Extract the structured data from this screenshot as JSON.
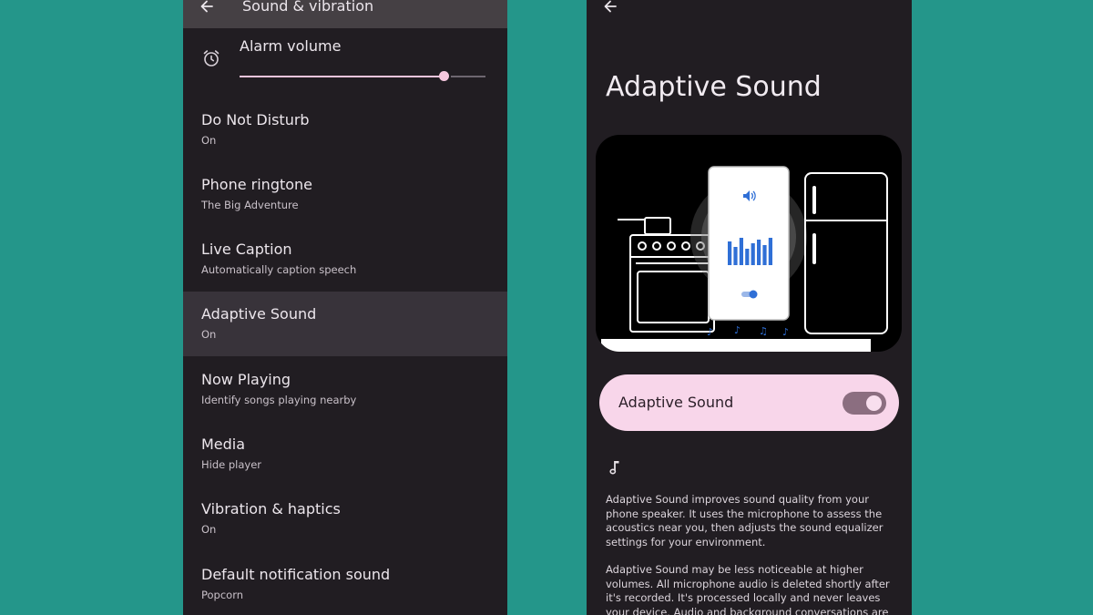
{
  "left": {
    "header": {
      "title": "Sound & vibration"
    },
    "alarm": {
      "label": "Alarm volume",
      "level": 0.83
    },
    "items": [
      {
        "title": "Do Not Disturb",
        "subtitle": "On"
      },
      {
        "title": "Phone ringtone",
        "subtitle": "The Big Adventure"
      },
      {
        "title": "Live Caption",
        "subtitle": "Automatically caption speech"
      },
      {
        "title": "Adaptive Sound",
        "subtitle": "On",
        "highlighted": true
      },
      {
        "title": "Now Playing",
        "subtitle": "Identify songs playing nearby"
      },
      {
        "title": "Media",
        "subtitle": "Hide player"
      },
      {
        "title": "Vibration & haptics",
        "subtitle": "On"
      },
      {
        "title": "Default notification sound",
        "subtitle": "Popcorn"
      }
    ]
  },
  "right": {
    "title": "Adaptive Sound",
    "toggle": {
      "label": "Adaptive Sound",
      "on": true
    },
    "description": [
      "Adaptive Sound improves sound quality from your phone speaker. It uses the microphone to assess the acoustics near you, then adjusts the sound equalizer settings for your environment.",
      "Adaptive Sound may be less noticeable at higher volumes. All microphone audio is deleted shortly after it's recorded. It's processed locally and never leaves your device. Audio and background conversations are never sent to Google."
    ]
  },
  "icons": [
    "back-arrow-icon",
    "alarm-clock-icon",
    "music-note-icon",
    "volume-icon"
  ],
  "colors": {
    "background": "#24968a",
    "panel": "#211d22",
    "accent_pink": "#f8d6ea",
    "eq_blue": "#2f6fd6"
  }
}
